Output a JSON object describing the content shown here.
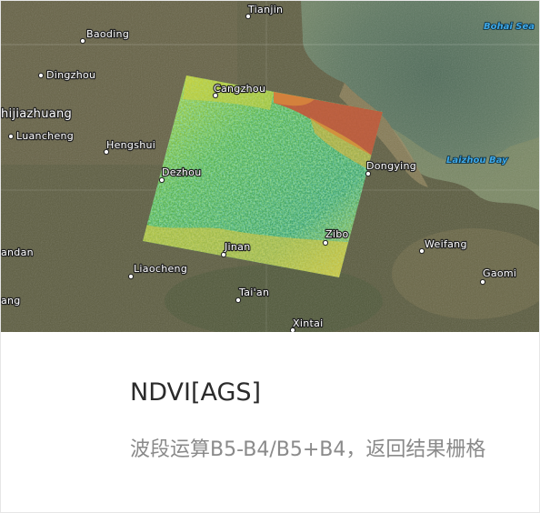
{
  "card": {
    "title": "NDVI[AGS]",
    "description": "波段运算B5-B4/B5+B4，返回结果栅格"
  },
  "map": {
    "places": [
      {
        "id": "tianjin",
        "name": "Tianjin"
      },
      {
        "id": "baoding",
        "name": "Baoding"
      },
      {
        "id": "dingzhou",
        "name": "Dingzhou"
      },
      {
        "id": "shijiazhuang",
        "name": "hijiazhuang"
      },
      {
        "id": "luancheng",
        "name": "Luancheng"
      },
      {
        "id": "hengshui",
        "name": "Hengshui"
      },
      {
        "id": "cangzhou",
        "name": "Cangzhou"
      },
      {
        "id": "dezhou",
        "name": "Dezhou"
      },
      {
        "id": "dongying",
        "name": "Dongying"
      },
      {
        "id": "zibo",
        "name": "Zibo"
      },
      {
        "id": "jinan",
        "name": "Jinan"
      },
      {
        "id": "weifang",
        "name": "Weifang"
      },
      {
        "id": "liaocheng",
        "name": "Liaocheng"
      },
      {
        "id": "handan",
        "name": "andan"
      },
      {
        "id": "gaomi",
        "name": "Gaomi"
      },
      {
        "id": "taian",
        "name": "Tai'an"
      },
      {
        "id": "xintai",
        "name": "Xintai"
      },
      {
        "id": "heze",
        "name": "ang"
      }
    ],
    "water_labels": [
      {
        "id": "bohai-sea",
        "name": "Bohai Sea"
      },
      {
        "id": "laizhou-bay",
        "name": "Laizhou Bay"
      }
    ],
    "overlay": {
      "name": "ndvi-raster",
      "colors": [
        "#2e9b6a",
        "#5fb84a",
        "#b9d431",
        "#e8c93a",
        "#c4553a"
      ]
    }
  }
}
